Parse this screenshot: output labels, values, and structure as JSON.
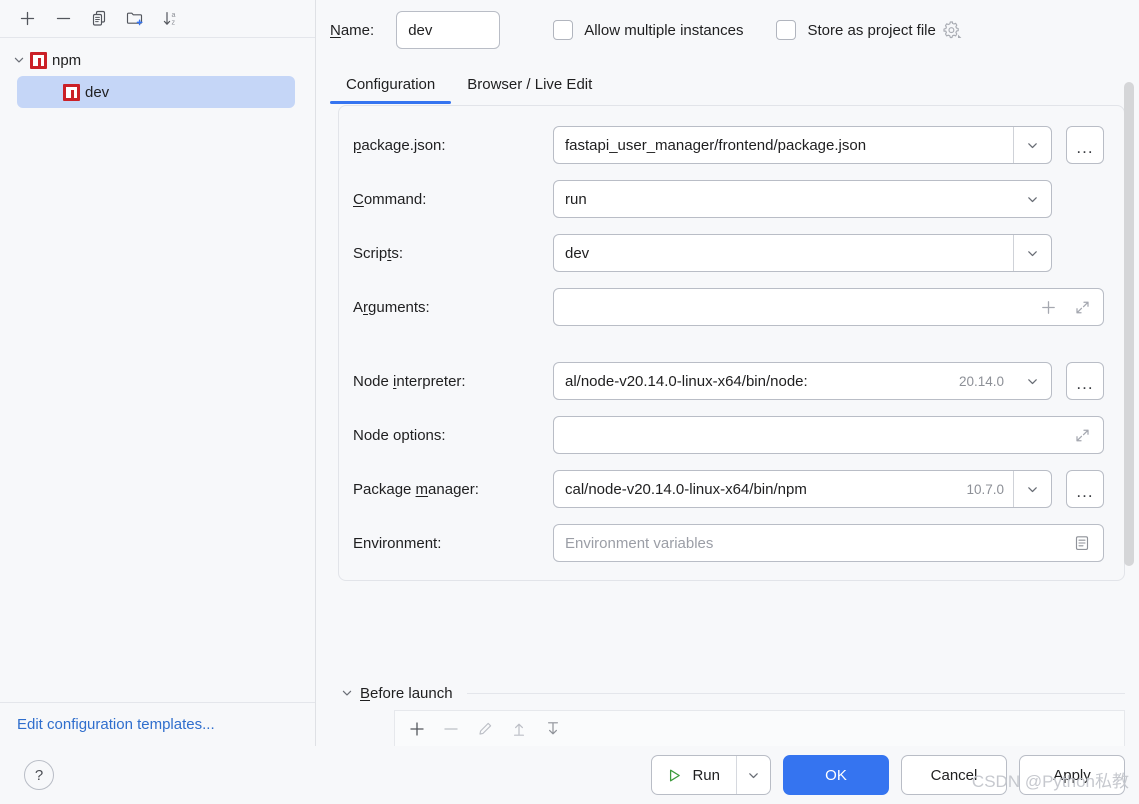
{
  "window": {
    "watermark": "CSDN @Python私教"
  },
  "sidebar": {
    "toolbar": [
      {
        "name": "add-configuration-button",
        "icon": "plus-icon",
        "title": "Add New Configuration"
      },
      {
        "name": "remove-configuration-button",
        "icon": "minus-icon",
        "title": "Remove Configuration"
      },
      {
        "name": "copy-configuration-button",
        "icon": "copy-icon",
        "title": "Copy Configuration"
      },
      {
        "name": "new-folder-button",
        "icon": "new-folder-icon",
        "title": "Create New Folder"
      },
      {
        "name": "sort-configurations-button",
        "icon": "sort-az-icon",
        "title": "Sort Configurations"
      }
    ],
    "tree": [
      {
        "label": "npm",
        "icon": "npm-icon",
        "expanded": true,
        "selected": false
      },
      {
        "label": "dev",
        "icon": "npm-icon",
        "expanded": false,
        "selected": true
      }
    ],
    "edit_templates_link": "Edit configuration templates..."
  },
  "header": {
    "name_label": "Name:",
    "name_mnemonic": "N",
    "name_value": "dev",
    "allow_multiple_instances_label": "Allow multiple instances",
    "allow_multiple_instances_checked": false,
    "store_as_project_file_label": "Store as project file",
    "store_as_project_file_checked": false,
    "gear_icon": "gear-icon"
  },
  "tabs": [
    {
      "label": "Configuration",
      "active": true
    },
    {
      "label": "Browser / Live Edit",
      "active": false
    }
  ],
  "form": {
    "group1": [
      {
        "name": "package-json",
        "label_pre": "",
        "label_mnemonic": "p",
        "label_post": "ackage.json:",
        "value": "fastapi_user_manager/frontend/package.json",
        "version": "",
        "has_chevron": true,
        "chevron_bordered": true,
        "has_browse": true,
        "browse_label": "...",
        "placeholder": ""
      },
      {
        "name": "command",
        "label_pre": "",
        "label_mnemonic": "C",
        "label_post": "ommand:",
        "value": "run",
        "version": "",
        "has_chevron": true,
        "chevron_bordered": false,
        "has_browse": false,
        "browse_label": "",
        "placeholder": ""
      },
      {
        "name": "scripts",
        "label_pre": "Scrip",
        "label_mnemonic": "t",
        "label_post": "s:",
        "value": "dev",
        "version": "",
        "has_chevron": true,
        "chevron_bordered": true,
        "has_browse": false,
        "browse_label": "",
        "placeholder": ""
      },
      {
        "name": "arguments",
        "label_pre": "A",
        "label_mnemonic": "r",
        "label_post": "guments:",
        "value": "",
        "version": "",
        "has_chevron": false,
        "chevron_bordered": false,
        "has_browse": false,
        "browse_label": "",
        "placeholder": "",
        "trailing_icons": [
          "plus-icon",
          "expand-icon"
        ]
      }
    ],
    "group2": [
      {
        "name": "node-interpreter",
        "label_pre": "Node ",
        "label_mnemonic": "i",
        "label_post": "nterpreter:",
        "value": ":al/node-v20.14.0-linux-x64/bin/node",
        "version": "20.14.0",
        "has_chevron": true,
        "chevron_bordered": false,
        "has_browse": true,
        "browse_label": "...",
        "placeholder": ""
      },
      {
        "name": "node-options",
        "label_pre": "Node options:",
        "label_mnemonic": "",
        "label_post": "",
        "value": "",
        "version": "",
        "has_chevron": false,
        "chevron_bordered": false,
        "has_browse": false,
        "browse_label": "",
        "placeholder": "",
        "trailing_icons": [
          "expand-icon"
        ]
      },
      {
        "name": "package-manager",
        "label_pre": "Package ",
        "label_mnemonic": "m",
        "label_post": "anager:",
        "value": "cal/node-v20.14.0-linux-x64/bin/npm",
        "version": "10.7.0",
        "has_chevron": true,
        "chevron_bordered": true,
        "has_browse": true,
        "browse_label": "...",
        "placeholder": ""
      },
      {
        "name": "environment",
        "label_pre": "Environment:",
        "label_mnemonic": "",
        "label_post": "",
        "value": "",
        "version": "",
        "has_chevron": false,
        "chevron_bordered": false,
        "has_browse": false,
        "browse_label": "",
        "placeholder": "Environment variables",
        "trailing_icons": [
          "list-edit-icon"
        ]
      }
    ]
  },
  "before_launch": {
    "title_pre": "",
    "title_mnemonic": "B",
    "title_post": "efore launch",
    "expanded": true,
    "toolbar": [
      {
        "name": "bl-add-button",
        "icon": "plus-icon",
        "enabled": true
      },
      {
        "name": "bl-remove-button",
        "icon": "minus-icon",
        "enabled": false
      },
      {
        "name": "bl-edit-button",
        "icon": "pencil-icon",
        "enabled": false
      },
      {
        "name": "bl-move-up-button",
        "icon": "arrow-up-icon",
        "enabled": false
      },
      {
        "name": "bl-move-down-button",
        "icon": "arrow-down-icon",
        "enabled": false
      }
    ]
  },
  "footer": {
    "help_label": "?",
    "run_label": "Run",
    "ok_label": "OK",
    "cancel_label": "Cancel",
    "apply_label": "Apply"
  },
  "colors": {
    "accent": "#3574f0",
    "selection": "#c5d6f7",
    "npm_red": "#cb2027",
    "link": "#2f6ecd",
    "run_green": "#3c9a3c"
  }
}
